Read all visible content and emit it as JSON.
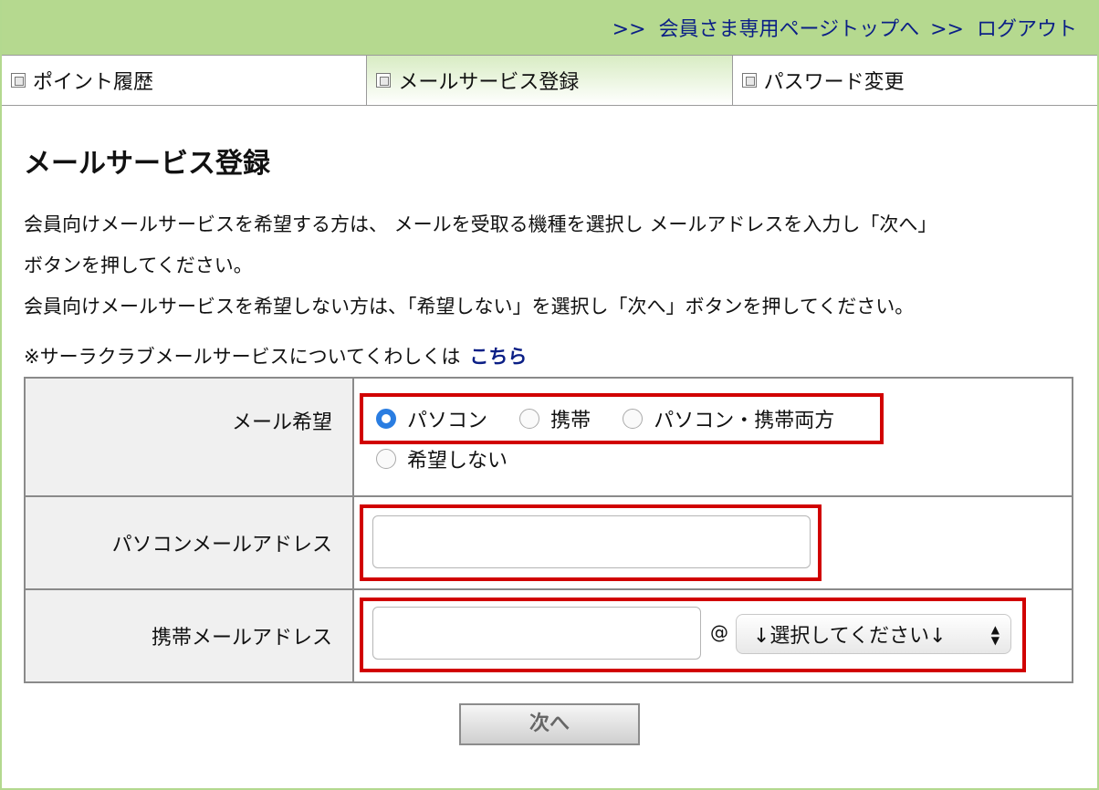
{
  "topnav": {
    "sep": ">>",
    "member_top": "会員さま専用ページトップへ",
    "logout": "ログアウト"
  },
  "tabs": [
    {
      "label": "ポイント履歴"
    },
    {
      "label": "メールサービス登録"
    },
    {
      "label": "パスワード変更"
    }
  ],
  "page": {
    "title": "メールサービス登録",
    "desc1": "会員向けメールサービスを希望する方は、 メールを受取る機種を選択し メールアドレスを入力し「次へ」",
    "desc2": "ボタンを押してください。",
    "desc3": "会員向けメールサービスを希望しない方は、「希望しない」を選択し「次へ」ボタンを押してください。",
    "note": "※サーラクラブメールサービスについてくわしくは",
    "note_link": "こちら"
  },
  "form": {
    "mail_pref_label": "メール希望",
    "options": [
      "パソコン",
      "携帯",
      "パソコン・携帯両方",
      "希望しない"
    ],
    "selected_option": "パソコン",
    "pc_label": "パソコンメールアドレス",
    "pc_value": "",
    "mobile_label": "携帯メールアドレス",
    "mobile_value": "",
    "at": "@",
    "domain_select": "↓選択してください↓",
    "next_button": "次へ"
  },
  "colors": {
    "header_green": "#b5d98f",
    "link_blue": "#0b1f86",
    "highlight_red": "#d10000",
    "radio_blue": "#2a7de1"
  }
}
